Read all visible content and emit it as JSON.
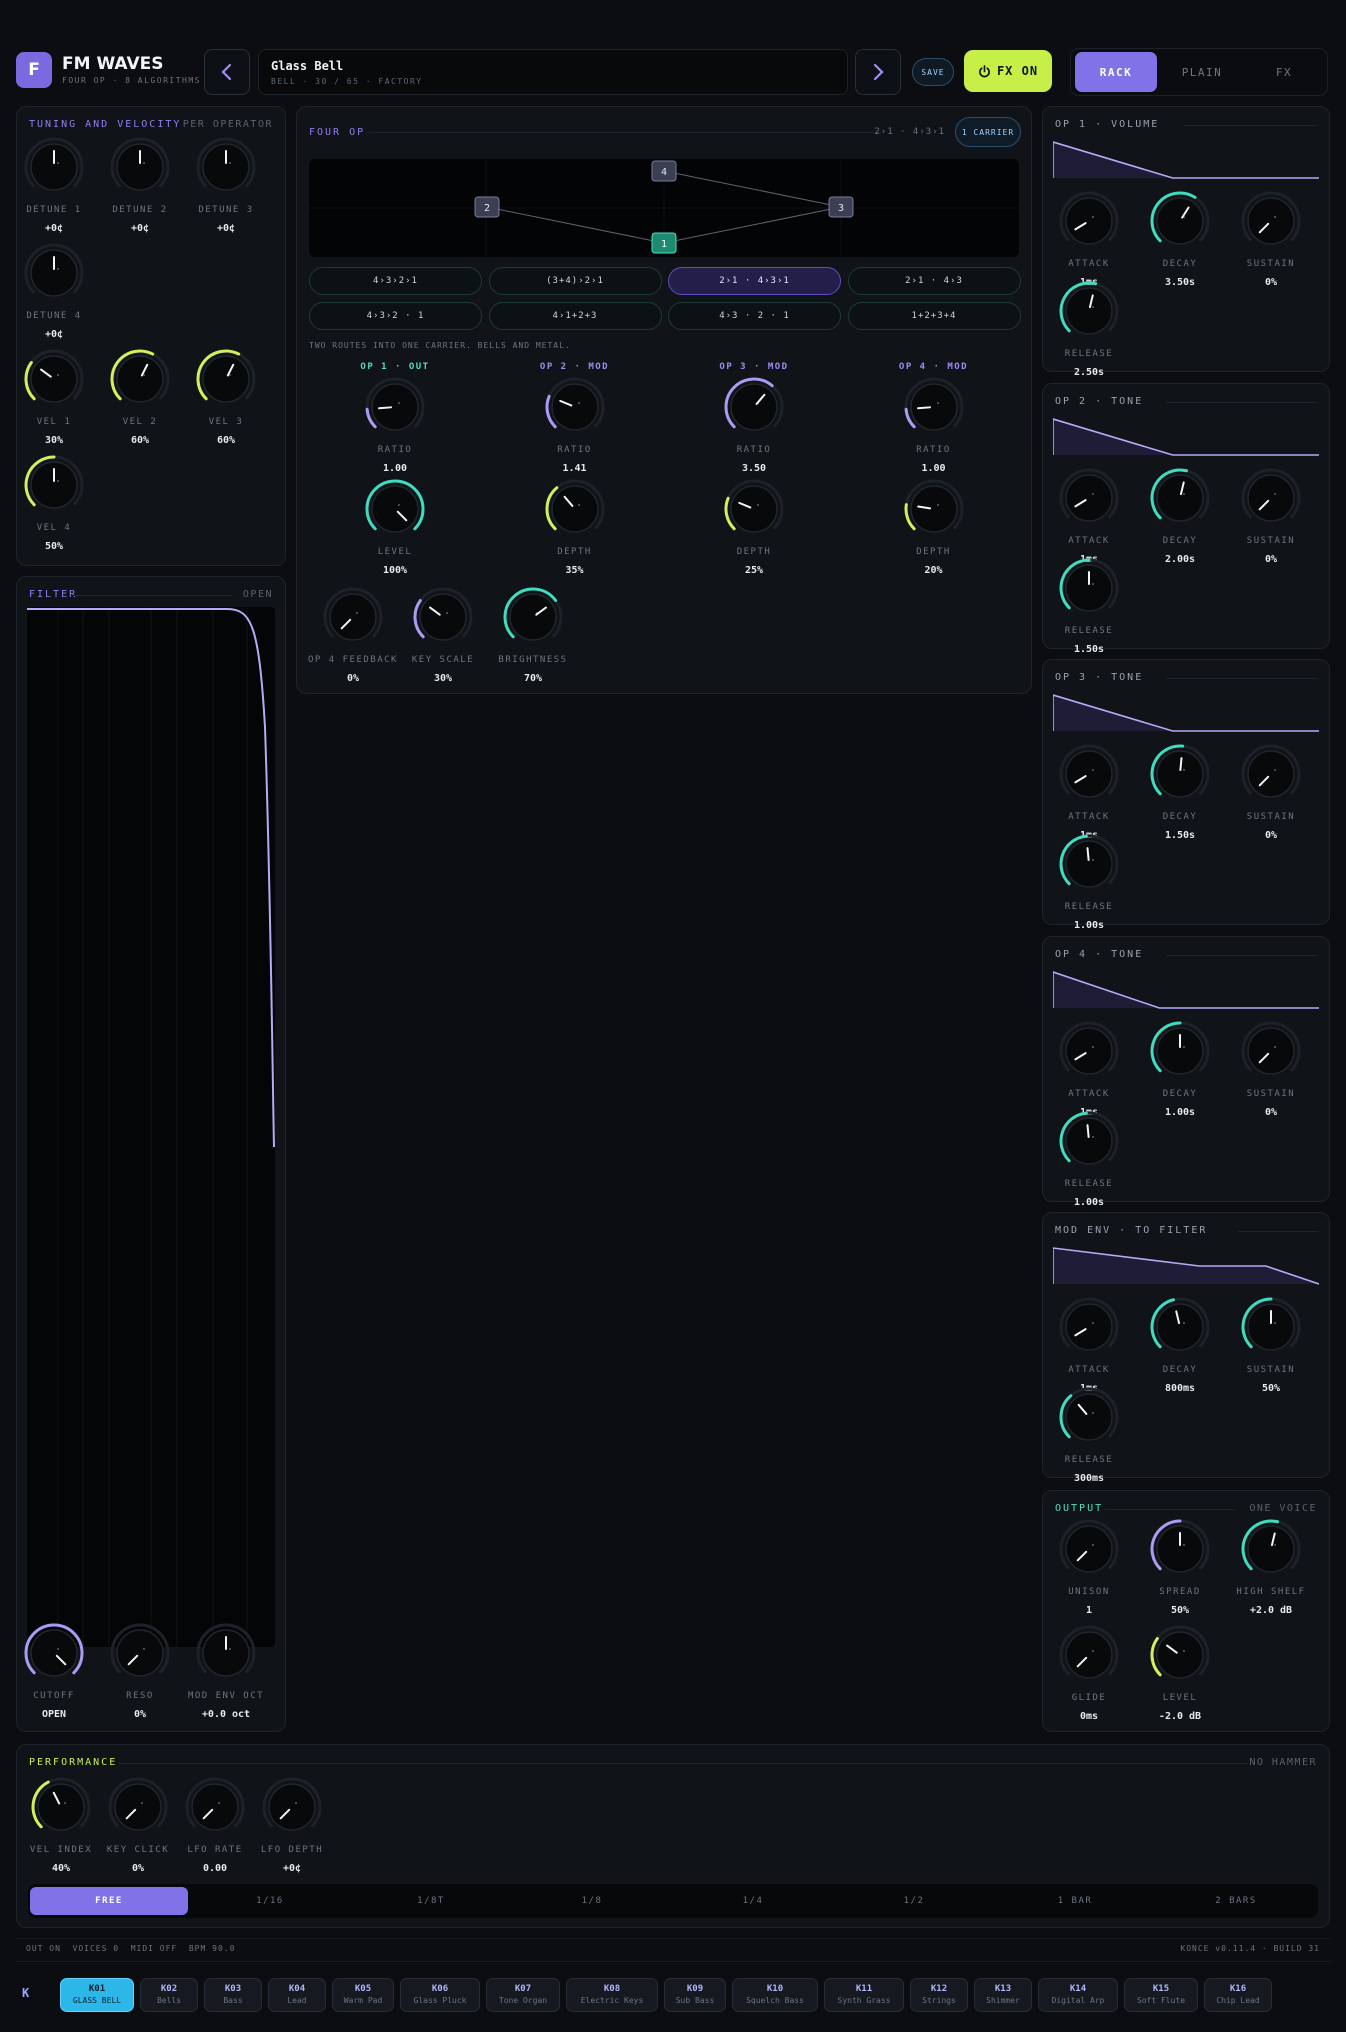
{
  "header": {
    "logo_letter": "F",
    "app_title": "FM WAVES",
    "app_subtitle": "FOUR OP · 8 ALGORITHMS",
    "preset_name": "Glass Bell",
    "preset_meta": "BELL · 30 / 65 · FACTORY",
    "save_label": "SAVE",
    "fx_toggle_label": "FX ON",
    "view_tabs": [
      "RACK",
      "PLAIN",
      "FX"
    ],
    "active_view": "RACK"
  },
  "tuning": {
    "title": "TUNING AND VELOCITY",
    "right_label": "PER OPERATOR",
    "knobs": [
      {
        "label": "DETUNE 1",
        "value": "+0¢",
        "level": 0.5,
        "arc": "none"
      },
      {
        "label": "DETUNE 2",
        "value": "+0¢",
        "level": 0.5,
        "arc": "none"
      },
      {
        "label": "DETUNE 3",
        "value": "+0¢",
        "level": 0.5,
        "arc": "none"
      },
      {
        "label": "DETUNE 4",
        "value": "+0¢",
        "level": 0.5,
        "arc": "none"
      },
      {
        "label": "VEL 1",
        "value": "30%",
        "level": 0.3,
        "arc": "yellow"
      },
      {
        "label": "VEL 2",
        "value": "60%",
        "level": 0.6,
        "arc": "yellow"
      },
      {
        "label": "VEL 3",
        "value": "60%",
        "level": 0.6,
        "arc": "yellow"
      },
      {
        "label": "VEL 4",
        "value": "50%",
        "level": 0.5,
        "arc": "yellow"
      }
    ]
  },
  "filter": {
    "title": "FILTER",
    "right_label": "OPEN",
    "knobs": [
      {
        "label": "CUTOFF",
        "value": "OPEN",
        "level": 1.0,
        "arc": "purple"
      },
      {
        "label": "RESO",
        "value": "0%",
        "level": 0.0,
        "arc": "none"
      },
      {
        "label": "MOD ENV OCT",
        "value": "+0.0 oct",
        "level": 0.5,
        "arc": "none"
      }
    ]
  },
  "fourop": {
    "title": "FOUR OP",
    "route_label": "2›1 · 4›3›1",
    "carrier_badge": "1 CARRIER",
    "nodes": [
      "1",
      "2",
      "3",
      "4"
    ],
    "algorithms": [
      "4›3›2›1",
      "(3+4)›2›1",
      "2›1 · 4›3›1",
      "2›1 · 4›3",
      "4›3›2 · 1",
      "4›1+2+3",
      "4›3 · 2 · 1",
      "1+2+3+4"
    ],
    "selected_algorithm": 2,
    "description": "TWO ROUTES INTO ONE CARRIER. BELLS AND METAL.",
    "operators": [
      {
        "title": "OP 1 · OUT",
        "ratio": {
          "label": "RATIO",
          "value": "1.00",
          "level": 0.15,
          "arc": "purple"
        },
        "amount": {
          "label": "LEVEL",
          "value": "100%",
          "level": 1.0,
          "arc": "teal"
        }
      },
      {
        "title": "OP 2 · MOD",
        "ratio": {
          "label": "RATIO",
          "value": "1.41",
          "level": 0.25,
          "arc": "purple"
        },
        "amount": {
          "label": "DEPTH",
          "value": "35%",
          "level": 0.35,
          "arc": "yellow"
        }
      },
      {
        "title": "OP 3 · MOD",
        "ratio": {
          "label": "RATIO",
          "value": "3.50",
          "level": 0.65,
          "arc": "purple"
        },
        "amount": {
          "label": "DEPTH",
          "value": "25%",
          "level": 0.25,
          "arc": "yellow"
        }
      },
      {
        "title": "OP 4 · MOD",
        "ratio": {
          "label": "RATIO",
          "value": "1.00",
          "level": 0.15,
          "arc": "purple"
        },
        "amount": {
          "label": "DEPTH",
          "value": "20%",
          "level": 0.2,
          "arc": "yellow"
        }
      }
    ],
    "extra_knobs": [
      {
        "label": "OP 4 FEEDBACK",
        "value": "0%",
        "level": 0.0,
        "arc": "none"
      },
      {
        "label": "KEY SCALE",
        "value": "30%",
        "level": 0.3,
        "arc": "purple"
      },
      {
        "label": "BRIGHTNESS",
        "value": "70%",
        "level": 0.7,
        "arc": "teal"
      }
    ]
  },
  "envelopes": [
    {
      "title": "OP 1 · VOLUME",
      "shape": [
        0,
        1,
        0.45,
        0,
        0.95,
        0,
        1,
        0
      ],
      "knobs": [
        {
          "label": "ATTACK",
          "value": "1ms",
          "level": 0.05,
          "arc": "none"
        },
        {
          "label": "DECAY",
          "value": "3.50s",
          "level": 0.62,
          "arc": "teal"
        },
        {
          "label": "SUSTAIN",
          "value": "0%",
          "level": 0.0,
          "arc": "none"
        },
        {
          "label": "RELEASE",
          "value": "2.50s",
          "level": 0.55,
          "arc": "teal"
        }
      ]
    },
    {
      "title": "OP 2 · TONE",
      "shape": [
        0,
        1,
        0.45,
        0,
        0.95,
        0,
        1,
        0
      ],
      "knobs": [
        {
          "label": "ATTACK",
          "value": "1ms",
          "level": 0.05,
          "arc": "none"
        },
        {
          "label": "DECAY",
          "value": "2.00s",
          "level": 0.55,
          "arc": "teal"
        },
        {
          "label": "SUSTAIN",
          "value": "0%",
          "level": 0.0,
          "arc": "none"
        },
        {
          "label": "RELEASE",
          "value": "1.50s",
          "level": 0.5,
          "arc": "teal"
        }
      ]
    },
    {
      "title": "OP 3 · TONE",
      "shape": [
        0,
        1,
        0.45,
        0,
        0.95,
        0,
        1,
        0
      ],
      "knobs": [
        {
          "label": "ATTACK",
          "value": "1ms",
          "level": 0.05,
          "arc": "none"
        },
        {
          "label": "DECAY",
          "value": "1.50s",
          "level": 0.52,
          "arc": "teal"
        },
        {
          "label": "SUSTAIN",
          "value": "0%",
          "level": 0.0,
          "arc": "none"
        },
        {
          "label": "RELEASE",
          "value": "1.00s",
          "level": 0.48,
          "arc": "teal"
        }
      ]
    },
    {
      "title": "OP 4 · TONE",
      "shape": [
        0,
        1,
        0.4,
        0,
        0.95,
        0,
        1,
        0
      ],
      "knobs": [
        {
          "label": "ATTACK",
          "value": "1ms",
          "level": 0.05,
          "arc": "none"
        },
        {
          "label": "DECAY",
          "value": "1.00s",
          "level": 0.5,
          "arc": "teal"
        },
        {
          "label": "SUSTAIN",
          "value": "0%",
          "level": 0.0,
          "arc": "none"
        },
        {
          "label": "RELEASE",
          "value": "1.00s",
          "level": 0.48,
          "arc": "teal"
        }
      ]
    },
    {
      "title": "MOD ENV · TO FILTER",
      "shape": [
        0,
        1,
        0.55,
        0.5,
        0.8,
        0.5,
        1,
        0
      ],
      "knobs": [
        {
          "label": "ATTACK",
          "value": "1ms",
          "level": 0.05,
          "arc": "none"
        },
        {
          "label": "DECAY",
          "value": "800ms",
          "level": 0.45,
          "arc": "teal"
        },
        {
          "label": "SUSTAIN",
          "value": "50%",
          "level": 0.5,
          "arc": "teal"
        },
        {
          "label": "RELEASE",
          "value": "300ms",
          "level": 0.35,
          "arc": "teal"
        }
      ]
    }
  ],
  "output": {
    "title": "OUTPUT",
    "right_label": "ONE VOICE",
    "knobs": [
      {
        "label": "UNISON",
        "value": "1",
        "level": 0.0,
        "arc": "none"
      },
      {
        "label": "SPREAD",
        "value": "50%",
        "level": 0.5,
        "arc": "purple"
      },
      {
        "label": "HIGH SHELF",
        "value": "+2.0 dB",
        "level": 0.55,
        "arc": "teal"
      },
      {
        "label": "GLIDE",
        "value": "0ms",
        "level": 0.0,
        "arc": "none"
      },
      {
        "label": "LEVEL",
        "value": "-2.0 dB",
        "level": 0.3,
        "arc": "yellow"
      }
    ]
  },
  "performance": {
    "title": "PERFORMANCE",
    "right_label": "NO HAMMER",
    "knobs": [
      {
        "label": "VEL INDEX",
        "value": "40%",
        "level": 0.4,
        "arc": "yellow"
      },
      {
        "label": "KEY CLICK",
        "value": "0%",
        "level": 0.0,
        "arc": "none"
      },
      {
        "label": "LFO RATE",
        "value": "0.00",
        "level": 0.0,
        "arc": "none"
      },
      {
        "label": "LFO DEPTH",
        "value": "+0¢",
        "level": 0.0,
        "arc": "none"
      }
    ],
    "sync": [
      "FREE",
      "1/16",
      "1/8T",
      "1/8",
      "1/4",
      "1/2",
      "1 BAR",
      "2 BARS"
    ],
    "selected_sync": 0
  },
  "status": {
    "left": "OUT ON  VOICES 0  MIDI OFF  BPM 90.0",
    "right": "KONCE v0.11.4 · BUILD 31"
  },
  "keys": {
    "letter": "K",
    "items": [
      {
        "id": "K01",
        "name": "GLASS BELL"
      },
      {
        "id": "K02",
        "name": "Bells"
      },
      {
        "id": "K03",
        "name": "Bass"
      },
      {
        "id": "K04",
        "name": "Lead"
      },
      {
        "id": "K05",
        "name": "Warm Pad"
      },
      {
        "id": "K06",
        "name": "Glass Pluck"
      },
      {
        "id": "K07",
        "name": "Tone Organ"
      },
      {
        "id": "K08",
        "name": "Electric Keys"
      },
      {
        "id": "K09",
        "name": "Sub Bass"
      },
      {
        "id": "K10",
        "name": "Squelch Bass"
      },
      {
        "id": "K11",
        "name": "Synth Grass"
      },
      {
        "id": "K12",
        "name": "Strings"
      },
      {
        "id": "K13",
        "name": "Shimmer"
      },
      {
        "id": "K14",
        "name": "Digital Arp"
      },
      {
        "id": "K15",
        "name": "Soft Flute"
      },
      {
        "id": "K16",
        "name": "Chip Lead"
      }
    ],
    "active": 0
  },
  "colors": {
    "purple": "#a99cf5",
    "teal": "#3fdcc0",
    "yellow": "#d2f05a",
    "accent_button": "#8073e8",
    "fx_green": "#c6f048"
  }
}
